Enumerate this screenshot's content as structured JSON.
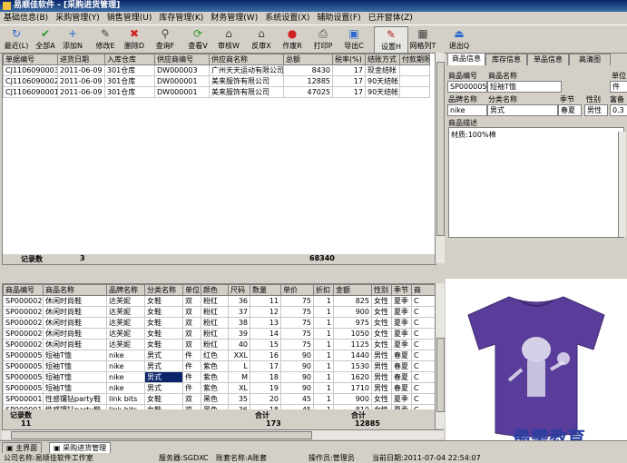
{
  "window": {
    "title": "易顺佳软件 - [采购进货管理]"
  },
  "menu": [
    "基础信息(B)",
    "采购管理(Y)",
    "销售管理(U)",
    "库存管理(K)",
    "财务管理(W)",
    "系统设置(X)",
    "辅助设置(F)",
    "已开窗体(Z)"
  ],
  "toolbar": [
    {
      "label": "最近(L)",
      "icon": "↻",
      "color": "#2a6ad0"
    },
    {
      "label": "全部A",
      "icon": "✔",
      "color": "#2a9a2a"
    },
    {
      "label": "添加N",
      "icon": "+",
      "color": "#2a6ad0"
    },
    {
      "label": "修改E",
      "icon": "✎",
      "color": "#444"
    },
    {
      "label": "删除D",
      "icon": "✖",
      "color": "#d02020"
    },
    {
      "label": "查询F",
      "icon": "⚲",
      "color": "#444"
    },
    {
      "label": "查看V",
      "icon": "⟳",
      "color": "#2a9a2a"
    },
    {
      "label": "审核W",
      "icon": "⌂",
      "color": "#444"
    },
    {
      "label": "反审X",
      "icon": "⌂",
      "color": "#444"
    },
    {
      "label": "作废R",
      "icon": "●",
      "color": "#d02020"
    },
    {
      "label": "打印P",
      "icon": "⎙",
      "color": "#444"
    },
    {
      "label": "导出C",
      "icon": "▣",
      "color": "#2a6ad0"
    },
    {
      "label": "设置H",
      "icon": "✎",
      "color": "#b02020"
    },
    {
      "label": "网格列T",
      "icon": "▦",
      "color": "#444"
    },
    {
      "label": "退出Q",
      "icon": "⏏",
      "color": "#2a6ad0"
    }
  ],
  "orders": {
    "headers": [
      "单据编号",
      "进货日期",
      "入库仓库",
      "供应商编号",
      "供应商名称",
      "总额",
      "税率(%)",
      "结账方式",
      "付款期限"
    ],
    "rows": [
      [
        "CJ1106090003",
        "2011-06-09",
        "301仓库",
        "DW000003",
        "广州天天运动有限公司",
        "8430",
        "17",
        "现金结帐",
        ""
      ],
      [
        "CJ1106090002",
        "2011-06-09",
        "301仓库",
        "DW000001",
        "美来服饰有限公司",
        "12885",
        "17",
        "90天结帐",
        ""
      ],
      [
        "CJ1106090001",
        "2011-06-09",
        "301仓库",
        "DW000001",
        "美来服饰有限公司",
        "47025",
        "17",
        "90天结帐",
        ""
      ]
    ],
    "summary": {
      "label": "记录数",
      "count": "3",
      "total": "68340"
    }
  },
  "items": {
    "headers": [
      "商品编号",
      "商品名称",
      "品牌名称",
      "分类名称",
      "单位",
      "颜色",
      "尺码",
      "数量",
      "单价",
      "折扣",
      "金额",
      "性别",
      "季节",
      "商"
    ],
    "rows": [
      [
        "SP000002",
        "休闲时尚鞋",
        "达芙妮",
        "女鞋",
        "双",
        "粉红",
        "36",
        "11",
        "75",
        "1",
        "825",
        "女性",
        "夏季",
        "C"
      ],
      [
        "SP000002",
        "休闲时尚鞋",
        "达芙妮",
        "女鞋",
        "双",
        "粉红",
        "37",
        "12",
        "75",
        "1",
        "900",
        "女性",
        "夏季",
        "C"
      ],
      [
        "SP000002",
        "休闲时尚鞋",
        "达芙妮",
        "女鞋",
        "双",
        "粉红",
        "38",
        "13",
        "75",
        "1",
        "975",
        "女性",
        "夏季",
        "C"
      ],
      [
        "SP000002",
        "休闲时尚鞋",
        "达芙妮",
        "女鞋",
        "双",
        "粉红",
        "39",
        "14",
        "75",
        "1",
        "1050",
        "女性",
        "夏季",
        "C"
      ],
      [
        "SP000002",
        "休闲时尚鞋",
        "达芙妮",
        "女鞋",
        "双",
        "粉红",
        "40",
        "15",
        "75",
        "1",
        "1125",
        "女性",
        "夏季",
        "C"
      ],
      [
        "SP000005",
        "短袖T恤",
        "nike",
        "男式",
        "件",
        "红色",
        "XXL",
        "16",
        "90",
        "1",
        "1440",
        "男性",
        "春夏",
        "C"
      ],
      [
        "SP000005",
        "短袖T恤",
        "nike",
        "男式",
        "件",
        "紫色",
        "L",
        "17",
        "90",
        "1",
        "1530",
        "男性",
        "春夏",
        "C"
      ],
      [
        "SP000005",
        "短袖T恤",
        "nike",
        "男式",
        "件",
        "紫色",
        "M",
        "18",
        "90",
        "1",
        "1620",
        "男性",
        "春夏",
        "C"
      ],
      [
        "SP000005",
        "短袖T恤",
        "nike",
        "男式",
        "件",
        "紫色",
        "XL",
        "19",
        "90",
        "1",
        "1710",
        "男性",
        "春夏",
        "C"
      ],
      [
        "SP000001",
        "性感镶钻party鞋",
        "link bits",
        "女鞋",
        "双",
        "黑色",
        "35",
        "20",
        "45",
        "1",
        "900",
        "女性",
        "夏季",
        "C"
      ],
      [
        "SP000001",
        "性感镶钻party鞋",
        "link bits",
        "女鞋",
        "双",
        "黑色",
        "36",
        "18",
        "45",
        "1",
        "810",
        "女性",
        "夏季",
        "C"
      ]
    ],
    "summary": {
      "label": "记录数",
      "count": "11",
      "qty_label": "合计",
      "qty": "173",
      "amt_label": "合计",
      "amt": "12885"
    }
  },
  "detail_tabs": [
    "商品信息",
    "库存信息",
    "单品信息",
    "高清图"
  ],
  "detail": {
    "code_label": "商品编号",
    "code": "SP000005",
    "name_label": "商品名称",
    "name": "短袖T恤",
    "unit_label": "单位",
    "unit": "件",
    "brand_label": "品牌名称",
    "brand": "nike",
    "category_label": "分类名称",
    "category": "男式",
    "season_label": "季节",
    "season": "春夏",
    "gender_label": "性别",
    "gender": "男性",
    "rate_label": "富备",
    "rate": "0.3",
    "desc_label": "商品描述",
    "desc": "材质:100%棉"
  },
  "bottom_tabs": [
    "主界面",
    "采购进货管理"
  ],
  "status": {
    "company": "公司名称:易顺佳软件工作室",
    "server": "服务器:SGDXC",
    "account": "账套名称:A账套",
    "operator": "操作员:管理员",
    "date": "当前日期:2011-07-04 22:54:07"
  },
  "watermark": "最需教育"
}
